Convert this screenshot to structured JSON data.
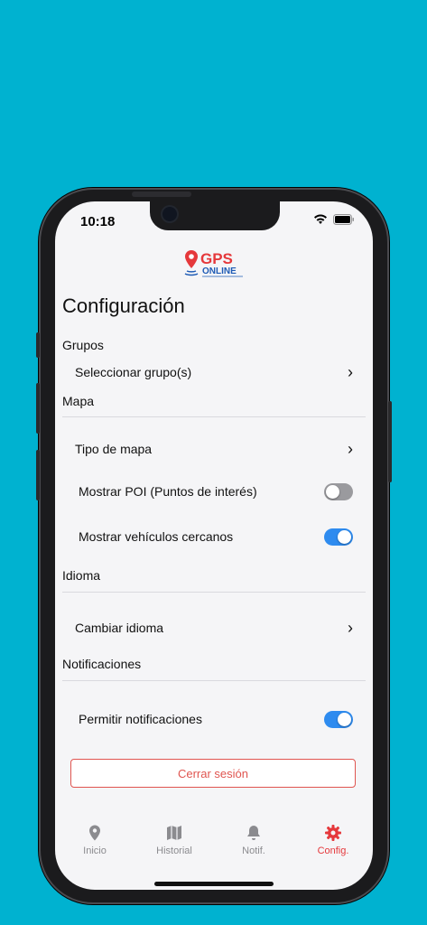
{
  "status": {
    "time": "10:18"
  },
  "logo": {
    "brand_top": "GPS",
    "brand_bottom": "ONLINE"
  },
  "page": {
    "title": "Configuración"
  },
  "sections": {
    "groups": "Grupos",
    "map": "Mapa",
    "language": "Idioma",
    "notifications": "Notificaciones"
  },
  "rows": {
    "select_groups": "Seleccionar grupo(s)",
    "map_type": "Tipo de mapa",
    "show_poi": "Mostrar POI (Puntos de interés)",
    "show_nearby": "Mostrar vehículos cercanos",
    "change_language": "Cambiar idioma",
    "allow_notifications": "Permitir notificaciones"
  },
  "toggles": {
    "show_poi": false,
    "show_nearby": true,
    "allow_notifications": true
  },
  "logout": {
    "label": "Cerrar sesión"
  },
  "tabs": [
    {
      "label": "Inicio",
      "icon": "location-pin-icon"
    },
    {
      "label": "Historial",
      "icon": "map-icon"
    },
    {
      "label": "Notif.",
      "icon": "bell-icon"
    },
    {
      "label": "Config.",
      "icon": "gear-icon"
    }
  ],
  "colors": {
    "accent": "#e5383b",
    "toggle_on": "#2e8bef",
    "background": "#00b2d0"
  }
}
